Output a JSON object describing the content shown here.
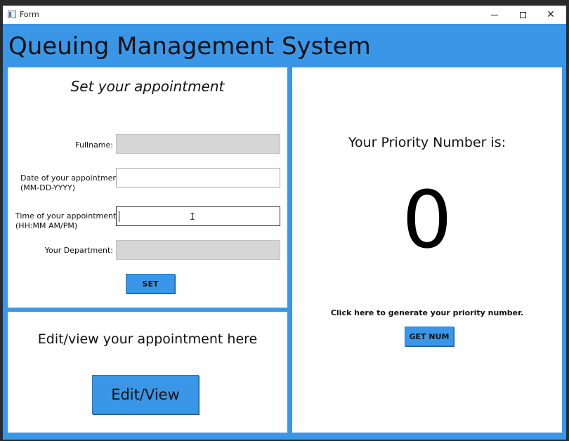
{
  "window": {
    "title": "Form",
    "controls": {
      "minimize": "—",
      "maximize": "□",
      "close": "✕"
    }
  },
  "app": {
    "title": "Queuing Management System"
  },
  "appointment_form": {
    "heading": "Set your appointment",
    "fullname_label": "Fullname:",
    "fullname_value": "",
    "date_label_line1": "Date of your appointment:",
    "date_label_line2": "(MM-DD-YYYY)",
    "date_value": "",
    "time_label_line1": "Time of your appointment:",
    "time_label_line2": "(HH:MM AM/PM)",
    "time_value": "",
    "department_label": "Your Department:",
    "department_value": "",
    "set_button": "SET"
  },
  "edit_panel": {
    "heading": "Edit/view your appointment here",
    "button": "Edit/View"
  },
  "priority_panel": {
    "label": "Your Priority Number is:",
    "number": "0",
    "hint": "Click here to generate your priority number.",
    "button": "GET NUM"
  },
  "colors": {
    "accent": "#3a97e8",
    "disabled_field": "#d6d6d6",
    "background": "#ffffff"
  },
  "icons": {
    "app": "window-app-icon",
    "cursor": "i-beam-cursor-icon"
  }
}
